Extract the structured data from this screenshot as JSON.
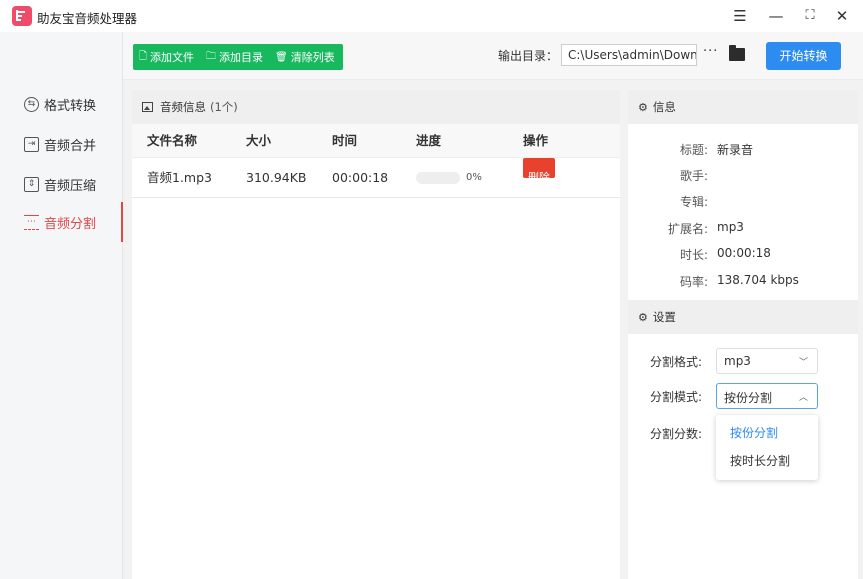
{
  "app": {
    "title": "助友宝音频处理器"
  },
  "window": {
    "menu": "☰",
    "minimize": "—",
    "maximize": "⛶",
    "close": "✕"
  },
  "sidebar": {
    "items": [
      {
        "label": "格式转换",
        "icon": "format-convert-icon"
      },
      {
        "label": "音频合并",
        "icon": "audio-merge-icon"
      },
      {
        "label": "音频压缩",
        "icon": "audio-compress-icon"
      },
      {
        "label": "音频分割",
        "icon": "audio-split-icon",
        "active": true
      }
    ]
  },
  "toolbar": {
    "add_file": "添加文件",
    "add_folder": "添加目录",
    "clear_list": "清除列表",
    "output_label": "输出目录：",
    "output_path": "C:\\Users\\admin\\Downlo",
    "more": "···",
    "start": "开始转换"
  },
  "file_panel": {
    "title": "音频信息",
    "count": "(1个)",
    "columns": [
      "文件名称",
      "大小",
      "时间",
      "进度",
      "操作"
    ],
    "rows": [
      {
        "name": "音频1.mp3",
        "size": "310.94KB",
        "time": "00:00:18",
        "progress": 0,
        "progress_text": "0%",
        "action": "删除"
      }
    ]
  },
  "info_panel": {
    "title": "信息",
    "fields": [
      {
        "key": "标题:",
        "value": "新录音"
      },
      {
        "key": "歌手:",
        "value": ""
      },
      {
        "key": "专辑:",
        "value": ""
      },
      {
        "key": "扩展名:",
        "value": "mp3"
      },
      {
        "key": "时长:",
        "value": "00:00:18"
      },
      {
        "key": "码率:",
        "value": "138.704 kbps"
      }
    ]
  },
  "settings": {
    "title": "设置",
    "split_format_label": "分割格式:",
    "split_format_value": "mp3",
    "split_mode_label": "分割模式:",
    "split_mode_value": "按份分割",
    "split_count_label": "分割分数:",
    "mode_options": [
      "按份分割",
      "按时长分割"
    ]
  },
  "colors": {
    "accent": "#2d8cf0",
    "green": "#18b85f",
    "active": "#e04848",
    "danger": "#e8412d"
  }
}
